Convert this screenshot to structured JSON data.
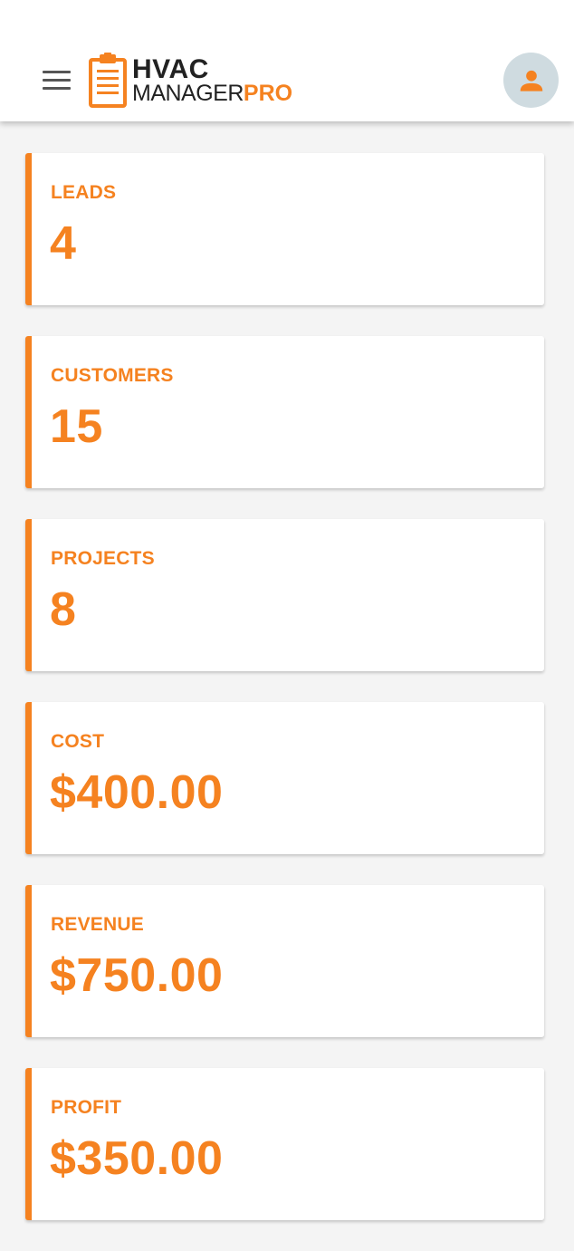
{
  "app": {
    "logo_line1": "HVAC",
    "logo_line2_prefix": "MANAGER",
    "logo_line2_suffix": "PRO"
  },
  "header": {
    "menu_icon": "hamburger-menu-icon",
    "avatar_icon": "person-icon"
  },
  "colors": {
    "accent": "#f58220",
    "header_bg": "#ffffff",
    "page_bg": "#f4f4f4",
    "avatar_bg": "#cfdbe0"
  },
  "stats": [
    {
      "label": "LEADS",
      "value": "4"
    },
    {
      "label": "CUSTOMERS",
      "value": "15"
    },
    {
      "label": "PROJECTS",
      "value": "8"
    },
    {
      "label": "COST",
      "value": "$400.00"
    },
    {
      "label": "REVENUE",
      "value": "$750.00"
    },
    {
      "label": "PROFIT",
      "value": "$350.00"
    }
  ]
}
